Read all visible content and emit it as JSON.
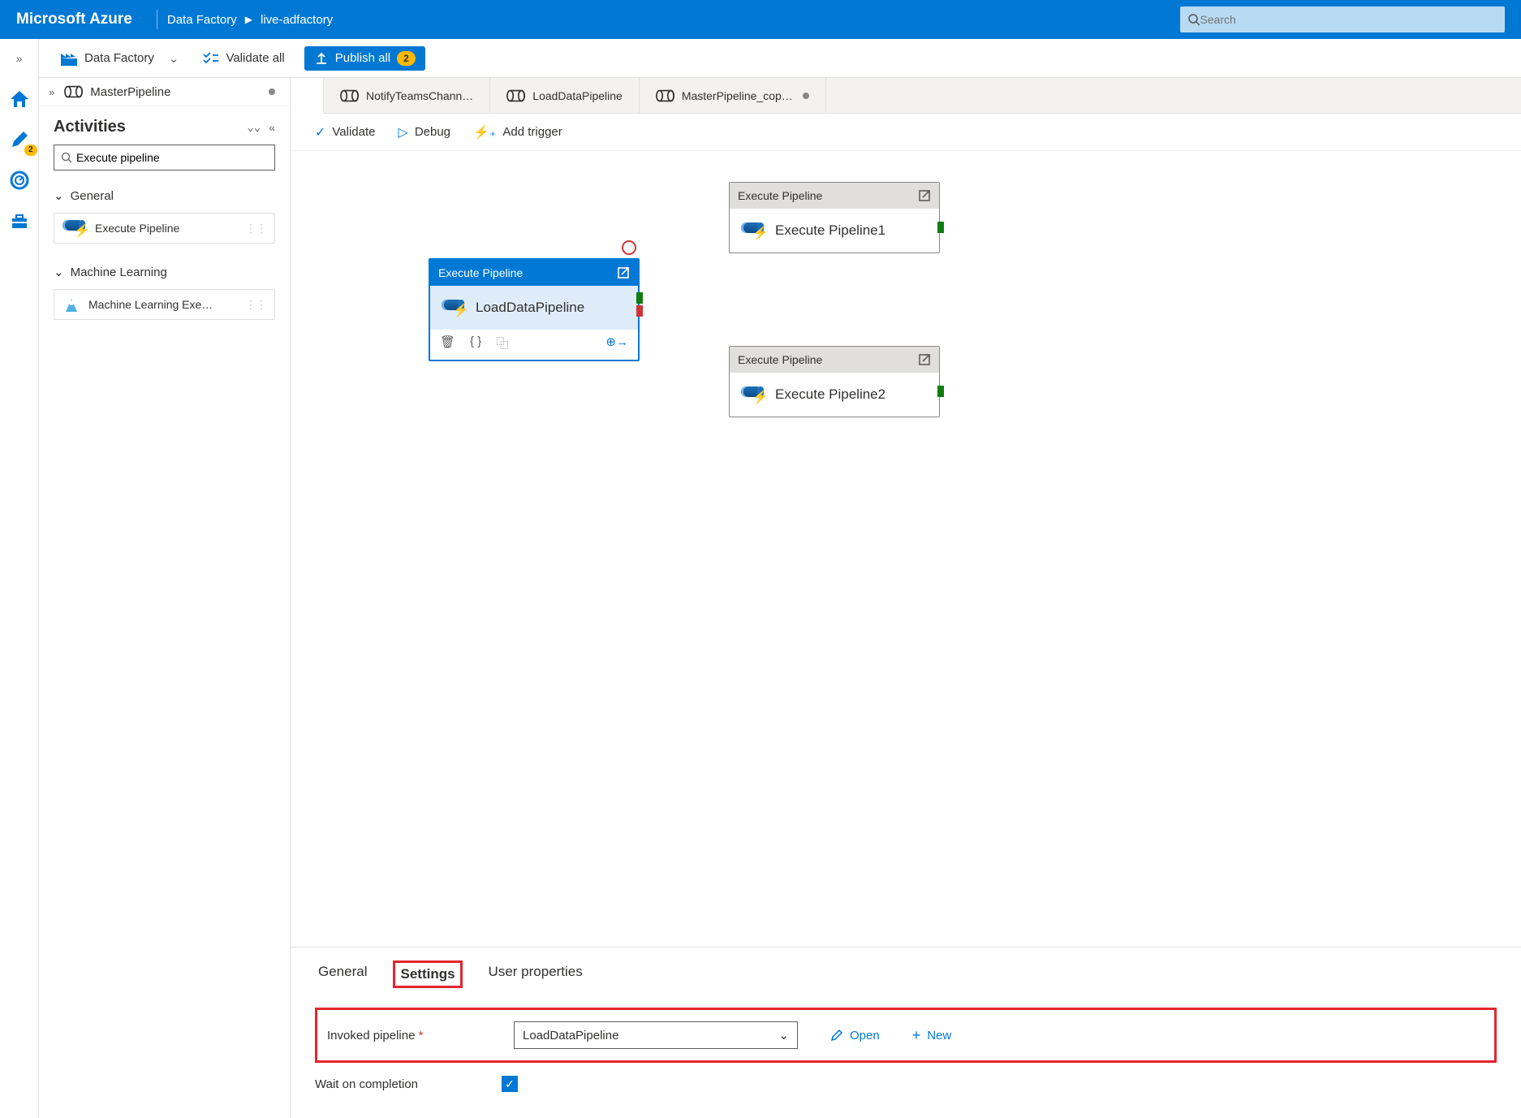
{
  "header": {
    "logo": "Microsoft Azure",
    "crumb1": "Data Factory",
    "crumb2": "live-adfactory",
    "search_placeholder": "Search"
  },
  "rail": {
    "pencil_badge": "2"
  },
  "servicebar": {
    "service_label": "Data Factory",
    "validate_all": "Validate all",
    "publish_all": "Publish all",
    "publish_badge": "2"
  },
  "authpanel": {
    "current_tab": "MasterPipeline",
    "activities_title": "Activities",
    "search_value": "Execute pipeline",
    "groups": {
      "general": {
        "label": "General",
        "item": "Execute Pipeline"
      },
      "ml": {
        "label": "Machine Learning",
        "item": "Machine Learning Exe…"
      }
    }
  },
  "tabs": [
    {
      "label": "NotifyTeamsChann…",
      "dirty": false
    },
    {
      "label": "LoadDataPipeline",
      "dirty": false
    },
    {
      "label": "MasterPipeline_cop…",
      "dirty": true
    }
  ],
  "toolbar": {
    "validate": "Validate",
    "debug": "Debug",
    "add_trigger": "Add trigger"
  },
  "canvas": {
    "selected": {
      "type": "Execute Pipeline",
      "name": "LoadDataPipeline"
    },
    "node1": {
      "type": "Execute Pipeline",
      "name": "Execute Pipeline1"
    },
    "node2": {
      "type": "Execute Pipeline",
      "name": "Execute Pipeline2"
    }
  },
  "props": {
    "tab_general": "General",
    "tab_settings": "Settings",
    "tab_userprops": "User properties",
    "invoked_label": "Invoked pipeline",
    "invoked_value": "LoadDataPipeline",
    "open": "Open",
    "new": "New",
    "wait_label": "Wait on completion",
    "wait_checked": true
  }
}
